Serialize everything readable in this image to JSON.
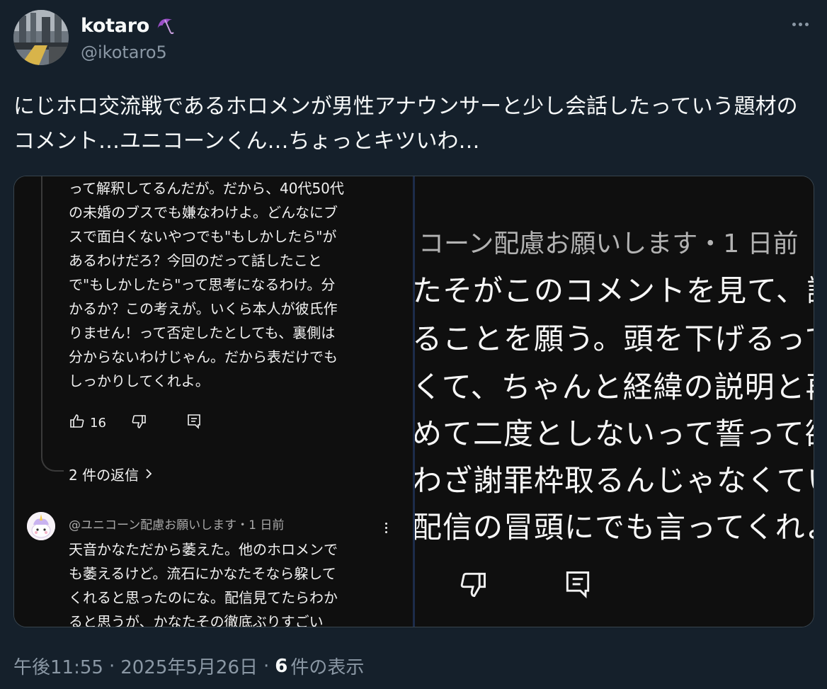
{
  "user": {
    "display_name": "kotaro",
    "emoji_icon": "umbrella-icon",
    "handle": "@ikotaro5"
  },
  "tweet": {
    "text": "にじホロ交流戦であるホロメンが男性アナウンサーと少し会話したっていう題材のコメント…ユニコーンくん…ちょっとキツいわ…"
  },
  "media": {
    "left": {
      "comment1_lines": [
        "って解釈してるんだが。だから、40代50代",
        "の未婚のブスでも嫌なわけよ。どんなにブ",
        "スで面白くないやつでも\"もしかしたら\"が",
        "あるわけだろ？今回のだって話したこと",
        "で\"もしかしたら\"って思考になるわけ。分",
        "かるか？この考えが。いくら本人が彼氏作",
        "りません！って否定したとしても、裏側は",
        "分からないわけじゃん。だから表だけでも",
        "しっかりしてくれよ。"
      ],
      "like_count": "16",
      "replies_label": "2 件の返信",
      "comment2_meta": "@ユニコーン配慮お願いします・1 日前",
      "comment2_lines": [
        "天音かなただから萎えた。他のホロメンで",
        "も萎えるけど。流石にかなたそなら躱して",
        "くれると思ったのにな。配信見てたらわか",
        "ると思うが、かなたその徹底ぶりすごい"
      ]
    },
    "right": {
      "meta": "コーン配慮お願いします・1 日前",
      "lines": [
        "たそがこのコメントを見て、謝",
        "ることを願う。頭を下げるって",
        "くて、ちゃんと経緯の説明と再",
        "めて二度としないって誓って欲",
        "わざ謝罪枠取るんじゃなくてい",
        "配信の冒頭にでも言ってくれよ"
      ]
    }
  },
  "footer": {
    "time": "午後11:55",
    "separator": "·",
    "date": "2025年5月26日",
    "views_count": "6",
    "views_label": "件の表示"
  }
}
